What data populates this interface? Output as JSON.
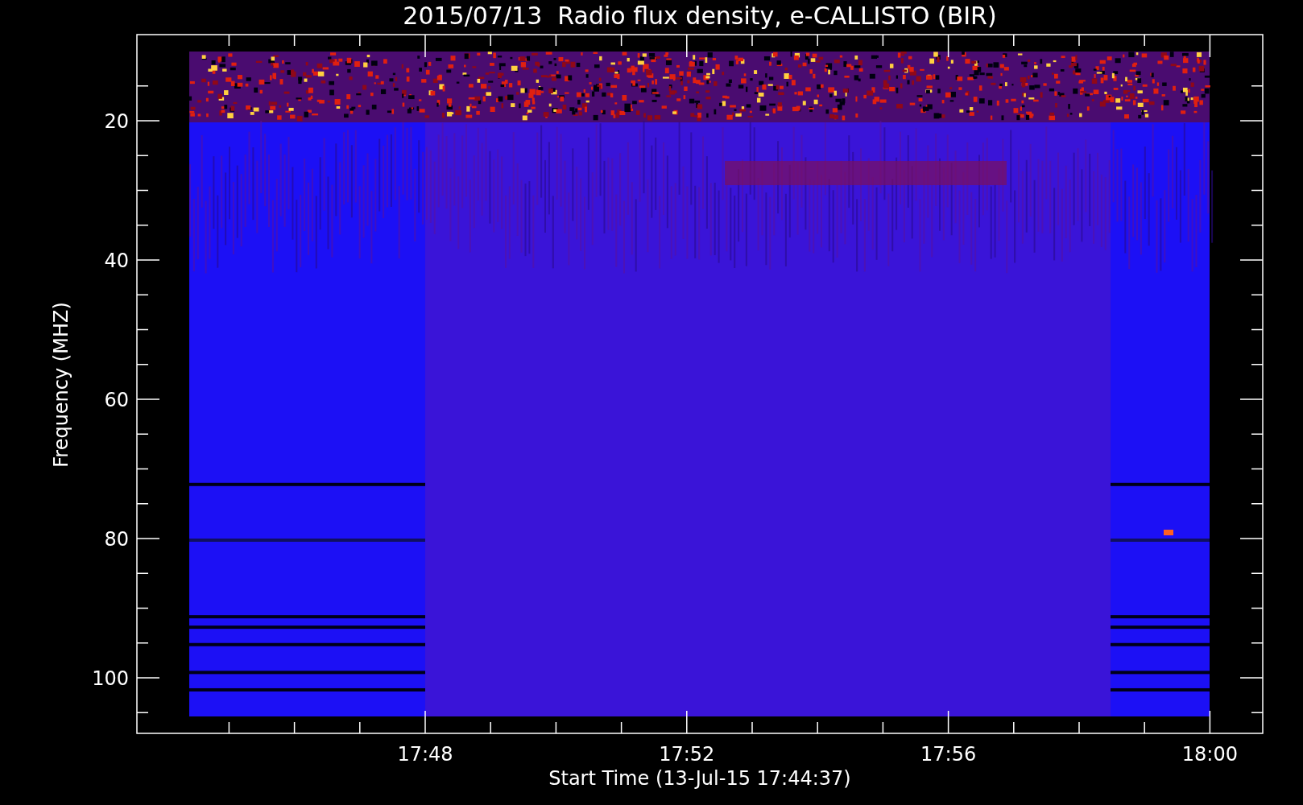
{
  "title": "2015/07/13  Radio flux density, e-CALLISTO (BIR)",
  "y_axis": {
    "label": "Frequency (MHZ)",
    "ticks": [
      "20",
      "40",
      "60",
      "80",
      "100"
    ]
  },
  "x_axis": {
    "label": "Start Time (13-Jul-15 17:44:37)",
    "ticks": [
      "17:48",
      "17:52",
      "17:56",
      "18:00"
    ]
  }
}
